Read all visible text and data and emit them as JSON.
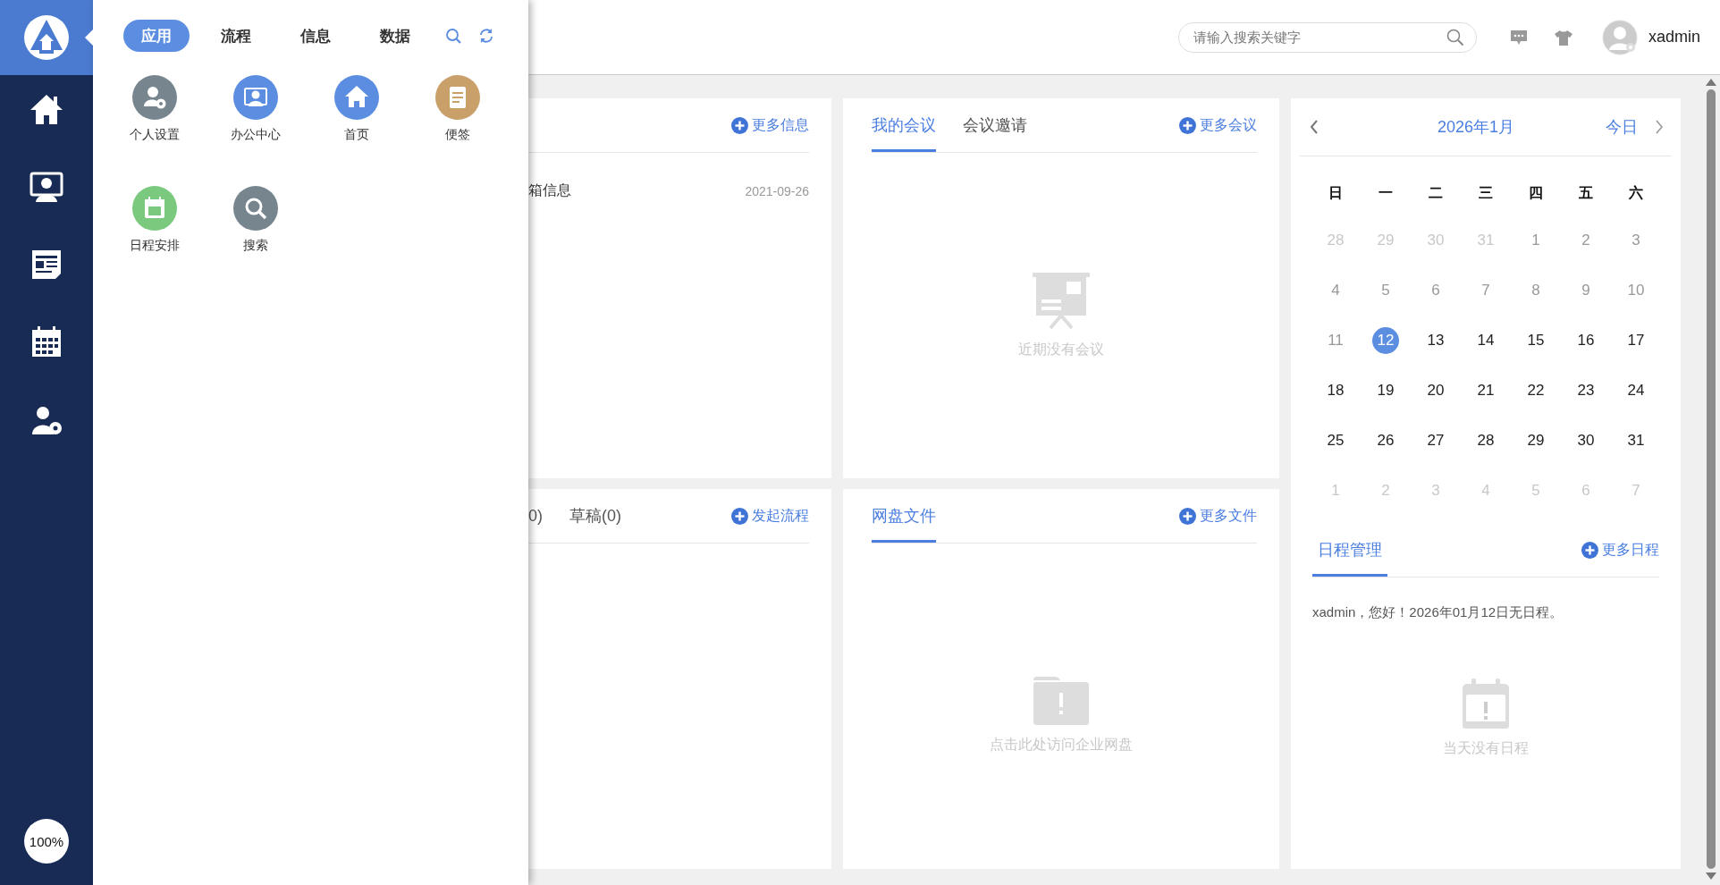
{
  "sidebar": {
    "zoom": "100%"
  },
  "drawer": {
    "tabs": [
      {
        "label": "应用",
        "selected": true
      },
      {
        "label": "流程",
        "selected": false
      },
      {
        "label": "信息",
        "selected": false
      },
      {
        "label": "数据",
        "selected": false
      }
    ],
    "apps": [
      {
        "label": "个人设置",
        "color": "#77858f"
      },
      {
        "label": "办公中心",
        "color": "#5b8ee0"
      },
      {
        "label": "首页",
        "color": "#5b8ee0"
      },
      {
        "label": "便签",
        "color": "#c9a06a"
      },
      {
        "label": "日程安排",
        "color": "#7bc97e"
      },
      {
        "label": "搜索",
        "color": "#77858f"
      }
    ]
  },
  "header": {
    "search": {
      "placeholder": "请输入搜索关键字"
    },
    "user": "xadmin"
  },
  "info_panel": {
    "more": "更多信息",
    "items": [
      {
        "title": "箱信息",
        "date": "2021-09-26"
      }
    ]
  },
  "meeting_panel": {
    "tabs": [
      {
        "label": "我的会议",
        "selected": true
      },
      {
        "label": "会议邀请",
        "selected": false
      }
    ],
    "more": "更多会议",
    "empty": "近期没有会议"
  },
  "flow_panel": {
    "tabs": [
      {
        "label": "0)",
        "selected": false
      },
      {
        "label": "草稿(0)",
        "selected": false
      }
    ],
    "more": "发起流程"
  },
  "files_panel": {
    "tabs": [
      {
        "label": "网盘文件",
        "selected": true
      }
    ],
    "more": "更多文件",
    "empty": "点击此处访问企业网盘"
  },
  "calendar": {
    "month": "2026年1月",
    "today": "今日",
    "weekdays": [
      "日",
      "一",
      "二",
      "三",
      "四",
      "五",
      "六"
    ],
    "weeks": [
      [
        {
          "label": "28",
          "kind": "outside",
          "selected": false
        },
        {
          "label": "29",
          "kind": "outside",
          "selected": false
        },
        {
          "label": "30",
          "kind": "outside",
          "selected": false
        },
        {
          "label": "31",
          "kind": "outside",
          "selected": false
        },
        {
          "label": "1",
          "kind": "past",
          "selected": false
        },
        {
          "label": "2",
          "kind": "past",
          "selected": false
        },
        {
          "label": "3",
          "kind": "past",
          "selected": false
        }
      ],
      [
        {
          "label": "4",
          "kind": "past",
          "selected": false
        },
        {
          "label": "5",
          "kind": "past",
          "selected": false
        },
        {
          "label": "6",
          "kind": "past",
          "selected": false
        },
        {
          "label": "7",
          "kind": "past",
          "selected": false
        },
        {
          "label": "8",
          "kind": "past",
          "selected": false
        },
        {
          "label": "9",
          "kind": "past",
          "selected": false
        },
        {
          "label": "10",
          "kind": "past",
          "selected": false
        }
      ],
      [
        {
          "label": "11",
          "kind": "past",
          "selected": false
        },
        {
          "label": "12",
          "kind": "current",
          "selected": true
        },
        {
          "label": "13",
          "kind": "current",
          "selected": false
        },
        {
          "label": "14",
          "kind": "current",
          "selected": false
        },
        {
          "label": "15",
          "kind": "current",
          "selected": false
        },
        {
          "label": "16",
          "kind": "current",
          "selected": false
        },
        {
          "label": "17",
          "kind": "current",
          "selected": false
        }
      ],
      [
        {
          "label": "18",
          "kind": "current",
          "selected": false
        },
        {
          "label": "19",
          "kind": "current",
          "selected": false
        },
        {
          "label": "20",
          "kind": "current",
          "selected": false
        },
        {
          "label": "21",
          "kind": "current",
          "selected": false
        },
        {
          "label": "22",
          "kind": "current",
          "selected": false
        },
        {
          "label": "23",
          "kind": "current",
          "selected": false
        },
        {
          "label": "24",
          "kind": "current",
          "selected": false
        }
      ],
      [
        {
          "label": "25",
          "kind": "current",
          "selected": false
        },
        {
          "label": "26",
          "kind": "current",
          "selected": false
        },
        {
          "label": "27",
          "kind": "current",
          "selected": false
        },
        {
          "label": "28",
          "kind": "current",
          "selected": false
        },
        {
          "label": "29",
          "kind": "current",
          "selected": false
        },
        {
          "label": "30",
          "kind": "current",
          "selected": false
        },
        {
          "label": "31",
          "kind": "current",
          "selected": false
        }
      ],
      [
        {
          "label": "1",
          "kind": "outside",
          "selected": false
        },
        {
          "label": "2",
          "kind": "outside",
          "selected": false
        },
        {
          "label": "3",
          "kind": "outside",
          "selected": false
        },
        {
          "label": "4",
          "kind": "outside",
          "selected": false
        },
        {
          "label": "5",
          "kind": "outside",
          "selected": false
        },
        {
          "label": "6",
          "kind": "outside",
          "selected": false
        },
        {
          "label": "7",
          "kind": "outside",
          "selected": false
        }
      ]
    ]
  },
  "schedule": {
    "tabs": [
      {
        "label": "日程管理",
        "selected": true
      }
    ],
    "more": "更多日程",
    "message": "xadmin，您好！2026年01月12日无日程。",
    "empty": "当天没有日程"
  }
}
